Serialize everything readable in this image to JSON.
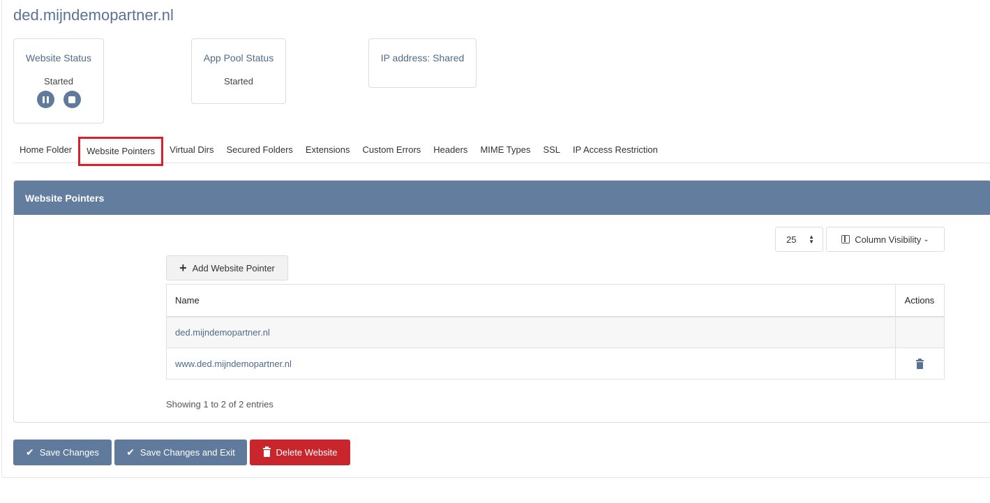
{
  "site": {
    "title": "ded.mijndemopartner.nl"
  },
  "cards": {
    "website_status": {
      "title": "Website Status",
      "value": "Started"
    },
    "app_pool_status": {
      "title": "App Pool Status",
      "value": "Started"
    },
    "ip_address": {
      "title": "IP address: Shared"
    }
  },
  "tabs": [
    {
      "label": "Home Folder"
    },
    {
      "label": "Website Pointers",
      "active": true
    },
    {
      "label": "Virtual Dirs"
    },
    {
      "label": "Secured Folders"
    },
    {
      "label": "Extensions"
    },
    {
      "label": "Custom Errors"
    },
    {
      "label": "Headers"
    },
    {
      "label": "MIME Types"
    },
    {
      "label": "SSL"
    },
    {
      "label": "IP Access Restriction"
    }
  ],
  "panel": {
    "title": "Website Pointers",
    "page_size": "25",
    "column_visibility_label": "Column Visibility",
    "add_button_label": "Add Website Pointer",
    "table": {
      "headers": [
        "Name",
        "Actions"
      ],
      "rows": [
        {
          "name": "ded.mijndemopartner.nl",
          "has_delete": false
        },
        {
          "name": "www.ded.mijndemopartner.nl",
          "has_delete": true
        }
      ]
    },
    "showing_text": "Showing 1 to 2 of 2 entries"
  },
  "footer": {
    "save_label": "Save Changes",
    "save_exit_label": "Save Changes and Exit",
    "delete_label": "Delete Website"
  },
  "colors": {
    "accent": "#5f7a9b",
    "panel_header": "#627d9e",
    "danger": "#c8262c",
    "highlight_box": "#d6232a"
  }
}
